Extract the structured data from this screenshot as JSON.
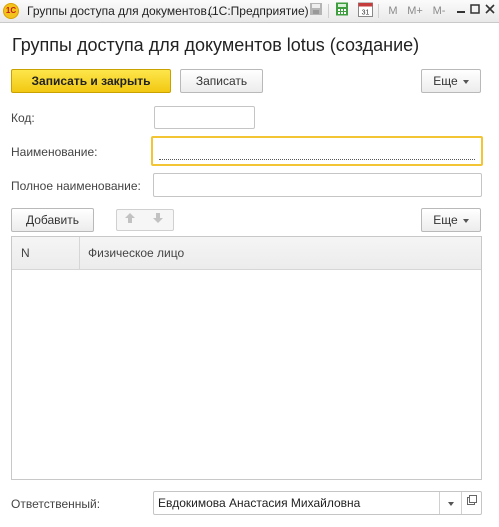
{
  "window": {
    "title": "Группы доступа для документов...",
    "app_name": "(1С:Предприятие)",
    "app_icon_text": "1С",
    "toolbar_icons": [
      "save-icon",
      "calculator-icon",
      "calendar-icon",
      "memory-m-icon",
      "memory-plus-icon",
      "memory-minus-icon",
      "minimize-icon",
      "maximize-icon",
      "close-icon"
    ],
    "toolbar_labels": {
      "m": "M",
      "m_plus": "M+",
      "m_minus": "M-",
      "calendar": "31"
    }
  },
  "form": {
    "heading": "Группы доступа для документов lotus (создание)",
    "buttons": {
      "save_close": "Записать и закрыть",
      "save": "Записать",
      "more": "Еще"
    },
    "fields": {
      "code_label": "Код:",
      "code_value": "",
      "name_label": "Наименование:",
      "name_value": "",
      "full_name_label": "Полное наименование:",
      "full_name_value": ""
    },
    "table_toolbar": {
      "add": "Добавить",
      "more": "Еще"
    },
    "table": {
      "columns": [
        "N",
        "Физическое лицо"
      ],
      "rows": []
    },
    "responsible": {
      "label": "Ответственный:",
      "value": "Евдокимова Анастасия Михайловна"
    }
  }
}
